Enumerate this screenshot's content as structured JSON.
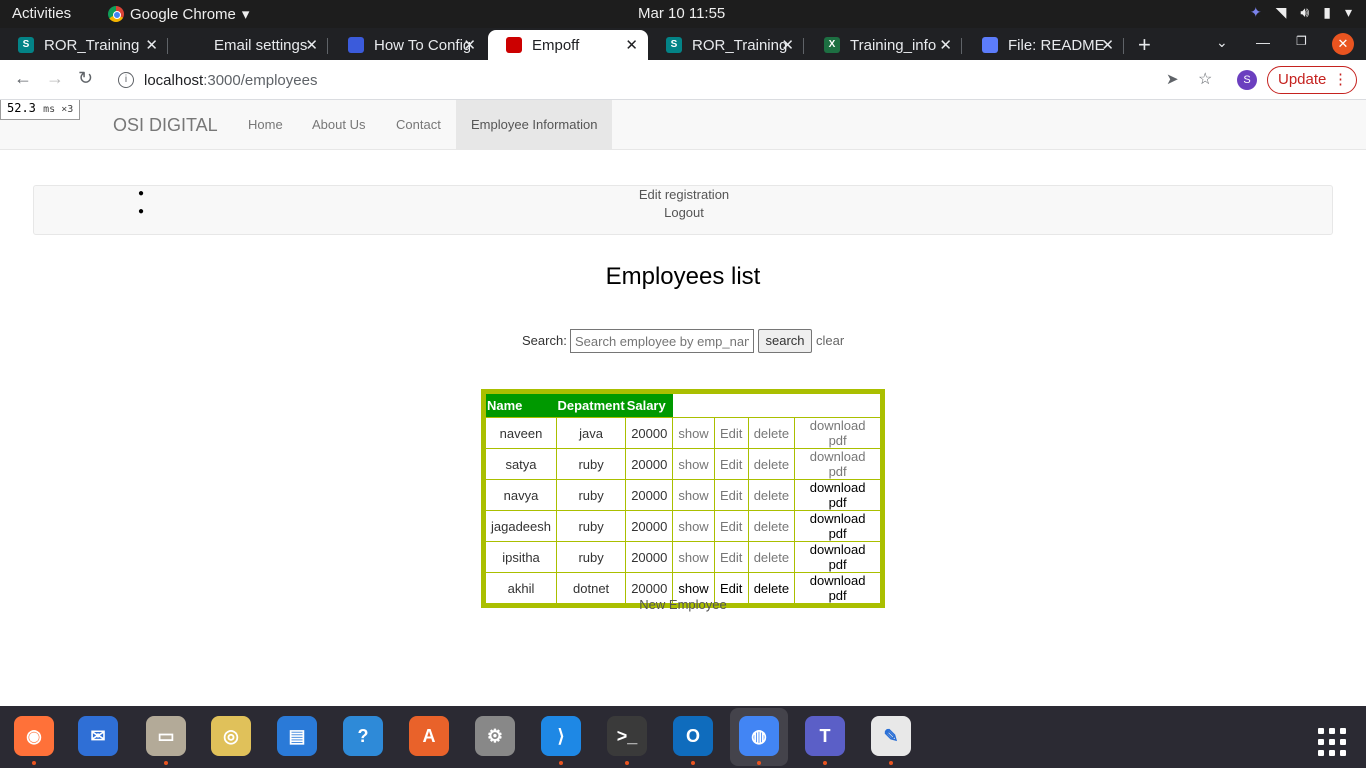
{
  "system_bar": {
    "activities": "Activities",
    "app_name": "Google Chrome",
    "clock": "Mar 10  11:55"
  },
  "tabs": [
    {
      "label": "ROR_Training",
      "favicon": "sharepoint-icon",
      "color": "#038387",
      "letter": "S"
    },
    {
      "label": "Email settings",
      "favicon": "github-icon",
      "color": "#202124",
      "letter": ""
    },
    {
      "label": "How To Config",
      "favicon": "digitalocean-icon",
      "color": "#3b5bdb",
      "letter": ""
    },
    {
      "label": "Empoff",
      "favicon": "rails-icon",
      "color": "#cc0000",
      "letter": ""
    },
    {
      "label": "ROR_Training",
      "favicon": "sharepoint-icon",
      "color": "#038387",
      "letter": "S"
    },
    {
      "label": "Training_info",
      "favicon": "excel-icon",
      "color": "#1d6f42",
      "letter": "X"
    },
    {
      "label": "File: README",
      "favicon": "file-icon",
      "color": "#5c7cfa",
      "letter": ""
    }
  ],
  "address_bar": {
    "host": "localhost",
    "path": ":3000/employees",
    "avatar_letter": "S",
    "update_label": "Update"
  },
  "perf_overlay": {
    "value": "52.3",
    "unit": "ms ×3"
  },
  "navbar": {
    "brand": "OSI DIGITAL",
    "items": [
      "Home",
      "About Us",
      "Contact",
      "Employee Information"
    ]
  },
  "user_menu": [
    "Edit registration",
    "Logout"
  ],
  "page_title": "Employees list",
  "search": {
    "label": "Search:",
    "placeholder": "Search employee by emp_name",
    "button": "search",
    "clear": "clear"
  },
  "table": {
    "headers": [
      "Name",
      "Depatment",
      "Salary"
    ],
    "rows": [
      {
        "name": "naveen",
        "dept": "java",
        "salary": "20000",
        "show": "show",
        "edit": "Edit",
        "delete": "delete",
        "pdf": "download pdf"
      },
      {
        "name": "satya",
        "dept": "ruby",
        "salary": "20000",
        "show": "show",
        "edit": "Edit",
        "delete": "delete",
        "pdf": "download pdf"
      },
      {
        "name": "navya",
        "dept": "ruby",
        "salary": "20000",
        "show": "show",
        "edit": "Edit",
        "delete": "delete",
        "pdf": "download pdf"
      },
      {
        "name": "jagadeesh",
        "dept": "ruby",
        "salary": "20000",
        "show": "show",
        "edit": "Edit",
        "delete": "delete",
        "pdf": "download pdf"
      },
      {
        "name": "ipsitha",
        "dept": "ruby",
        "salary": "20000",
        "show": "show",
        "edit": "Edit",
        "delete": "delete",
        "pdf": "download pdf"
      },
      {
        "name": "akhil",
        "dept": "dotnet",
        "salary": "20000",
        "show": "show",
        "edit": "Edit",
        "delete": "delete",
        "pdf": "download pdf"
      }
    ]
  },
  "new_employee": "New Employee",
  "dock": [
    {
      "name": "firefox-icon",
      "color": "#ff7139"
    },
    {
      "name": "thunderbird-icon",
      "color": "#2f6fd6"
    },
    {
      "name": "files-icon",
      "color": "#b3aa98"
    },
    {
      "name": "rhythmbox-icon",
      "color": "#e0c15a"
    },
    {
      "name": "writer-icon",
      "color": "#2a7ad8"
    },
    {
      "name": "help-icon",
      "color": "#2e8ad8"
    },
    {
      "name": "software-icon",
      "color": "#e9622a"
    },
    {
      "name": "settings-icon",
      "color": "#888888"
    },
    {
      "name": "vscode-icon",
      "color": "#1e88e5"
    },
    {
      "name": "terminal-icon",
      "color": "#3a3a3a"
    },
    {
      "name": "outlook-icon",
      "color": "#0f6cbd"
    },
    {
      "name": "chrome-icon",
      "color": "#4285f4"
    },
    {
      "name": "teams-icon",
      "color": "#5b5fc7"
    },
    {
      "name": "text-editor-icon",
      "color": "#e8e8e8"
    }
  ]
}
